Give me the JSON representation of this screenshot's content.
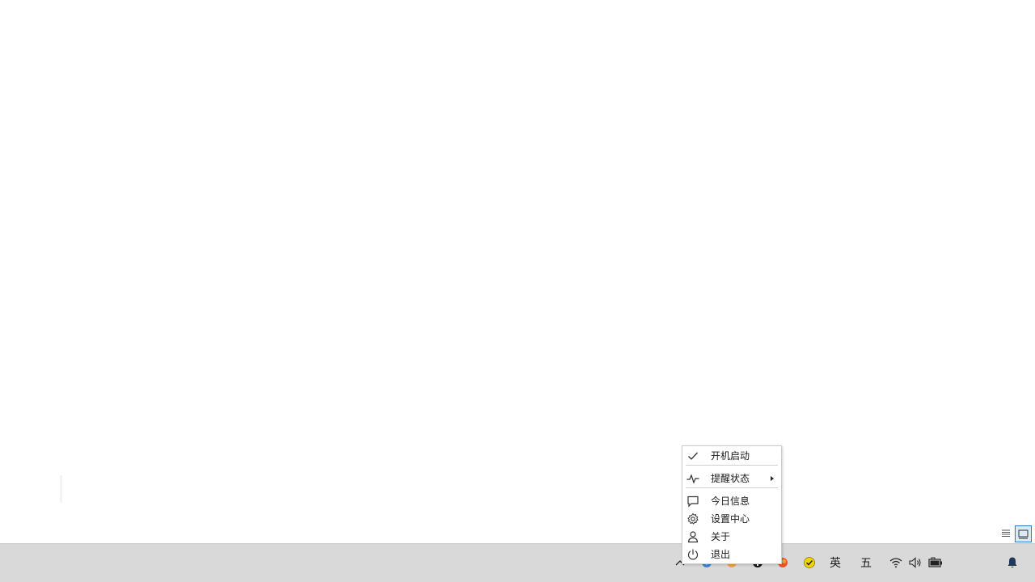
{
  "context_menu": {
    "items": [
      {
        "label": "开机启动",
        "icon": "checkmark-icon"
      },
      {
        "label": "提醒状态",
        "icon": "pulse-icon",
        "has_submenu": true
      },
      {
        "label": "今日信息",
        "icon": "message-icon"
      },
      {
        "label": "设置中心",
        "icon": "gear-icon"
      },
      {
        "label": "关于",
        "icon": "user-icon"
      },
      {
        "label": "退出",
        "icon": "power-icon"
      }
    ]
  },
  "taskbar": {
    "tray": {
      "show_hidden_icon": "chevron-up-icon",
      "app_icons": [
        "blue-app-icon",
        "orange-app-icon",
        "black-app-icon",
        "red-orange-app-icon",
        "yellow-check-icon"
      ],
      "ime_language": "英",
      "ime_mode": "五",
      "wifi_icon": "wifi-icon",
      "volume_icon": "volume-icon",
      "battery_icon": "battery-icon",
      "notification_icon": "notification-bell-icon"
    }
  },
  "colors": {
    "taskbar_bg": "#d9d9d9",
    "bell": "#1f3a5f",
    "yellow_check": "#f2d600",
    "selected_border": "#2b79c9"
  }
}
